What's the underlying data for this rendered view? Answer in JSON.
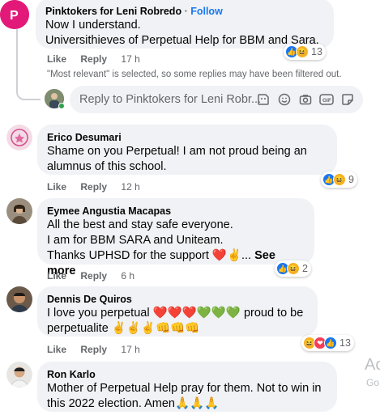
{
  "comments": [
    {
      "author": "Pinktokers for Leni Robredo",
      "follow": "Follow",
      "lines": [
        "Now I understand.",
        "Universithieves of Perpetual Help for BBM and Sara."
      ],
      "like": "Like",
      "reply": "Reply",
      "time": "17 h",
      "reaction_count": "13"
    },
    {
      "author": "Erico Desumari",
      "lines": [
        "Shame on you Perpetual! I am not proud being an",
        "alumnus of this school."
      ],
      "like": "Like",
      "reply": "Reply",
      "time": "12 h",
      "reaction_count": "9"
    },
    {
      "author": "Eymee Angustia Macapas",
      "lines": [
        "All the best and stay safe everyone.",
        "I am for BBM SARA and Uniteam.",
        "Thanks UPHSD for the support ❤️✌️..."
      ],
      "see_more": "See more",
      "like": "Like",
      "reply": "Reply",
      "time": "6 h",
      "reaction_count": "2"
    },
    {
      "author": "Dennis De Quiros",
      "lines": [
        "I love you perpetual ❤️❤️❤️💚💚💚 proud to be",
        "perpetualite ✌️✌️✌️👊👊👊"
      ],
      "like": "Like",
      "reply": "Reply",
      "time": "17 h",
      "reaction_count": "13"
    },
    {
      "author": "Ron Karlo",
      "lines": [
        "Mother of Perpetual Help pray for them. Not to win in",
        "this 2022 election. Amen🙏🙏🙏"
      ]
    }
  ],
  "filter_note": "\"Most relevant\" is selected, so some replies may have been filtered out.",
  "reply_placeholder": "Reply to Pinktokers for Leni Robr...",
  "side_text": [
    "Ac",
    "Go"
  ],
  "icons": {
    "sticker": "sticker-icon",
    "emoji": "emoji-icon",
    "camera": "camera-icon",
    "gif": "gif-icon",
    "sticker2": "sticker-icon"
  },
  "colors": {
    "like_blue": "#1877f2",
    "bubble": "#f0f2f5",
    "meta_gray": "#65676b"
  }
}
